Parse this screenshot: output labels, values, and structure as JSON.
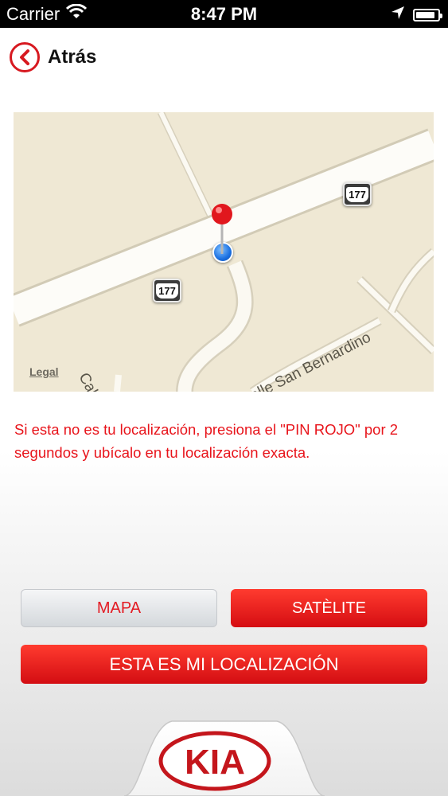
{
  "status_bar": {
    "carrier": "Carrier",
    "time": "8:47 PM",
    "battery_level": 0.9
  },
  "header": {
    "back_label": "Atrás"
  },
  "map": {
    "route_shields": [
      "177",
      "177"
    ],
    "street_labels": [
      "Calle",
      "Calle San Bernardino"
    ],
    "legal": "Legal"
  },
  "instructions": "Si esta no es tu localización, presiona el \"PIN ROJO\" por 2 segundos y ubícalo en tu localización exacta.",
  "buttons": {
    "map_label": "MAPA",
    "satellite_label": "SATÈLITE",
    "confirm_label": "ESTA ES MI LOCALIZACIÓN"
  },
  "logo": {
    "text": "KIA"
  },
  "colors": {
    "accent": "#e31b23",
    "map_bg": "#efe8d4"
  }
}
